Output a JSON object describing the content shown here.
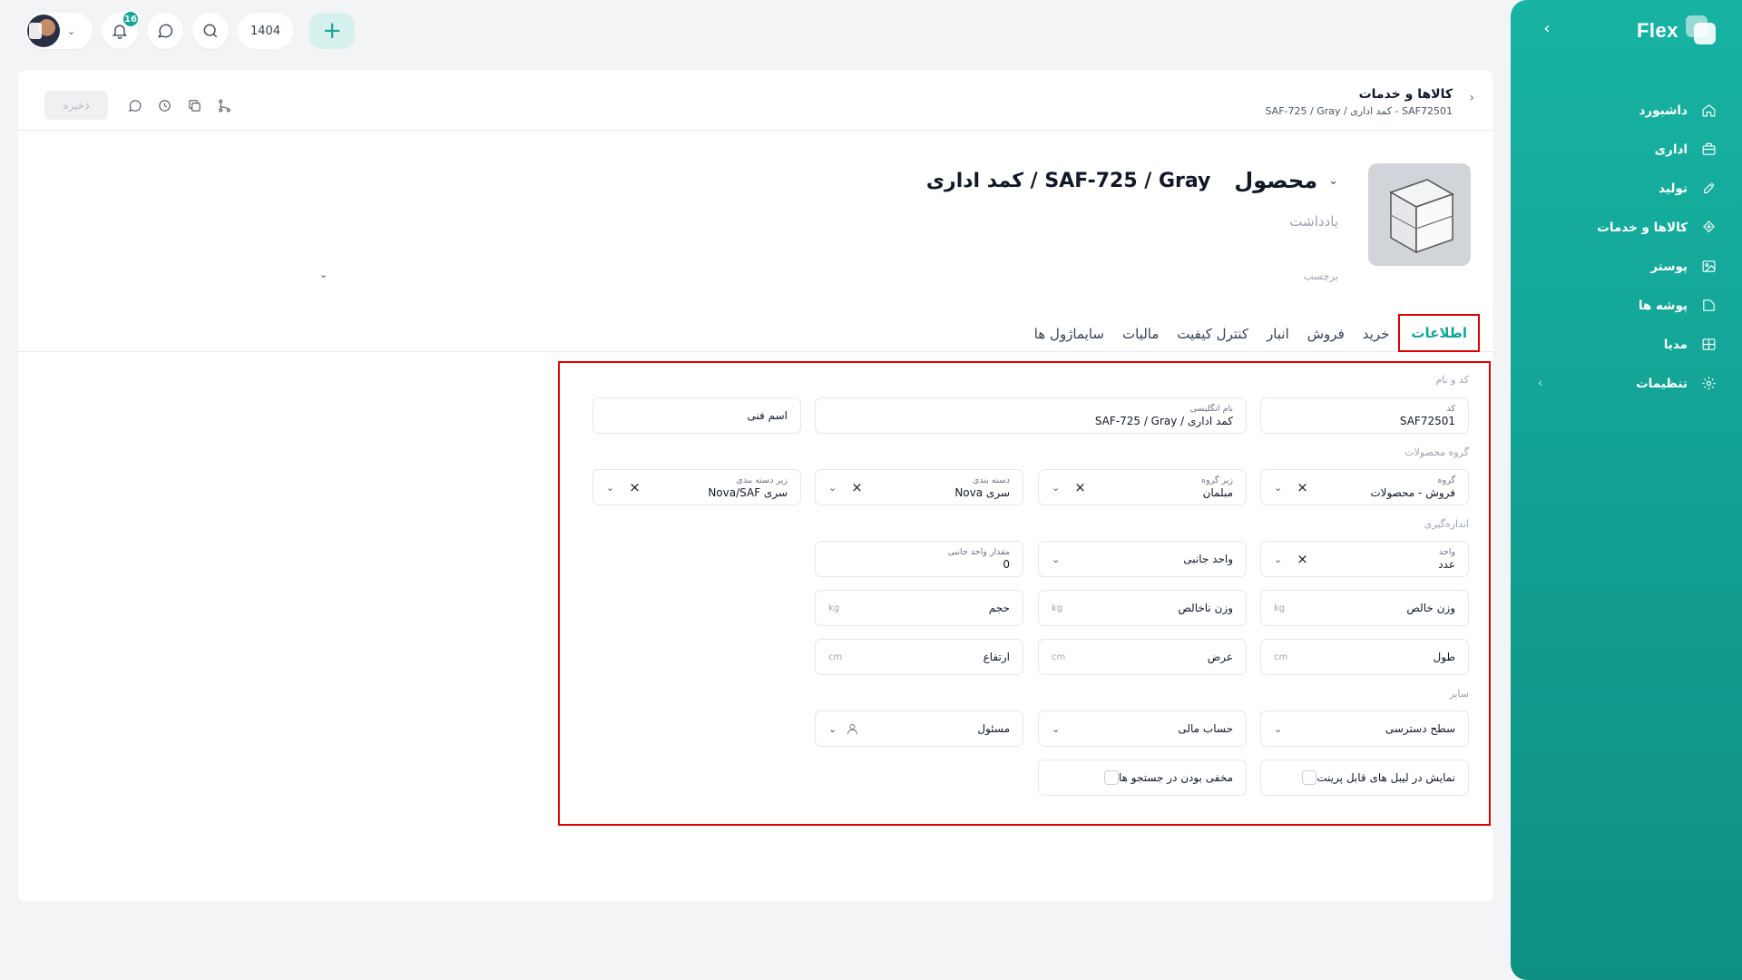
{
  "brand": {
    "name": "Flex"
  },
  "sidebar": {
    "items": [
      {
        "label": "داشبورد",
        "icon": "home-icon"
      },
      {
        "label": "اداری",
        "icon": "briefcase-icon"
      },
      {
        "label": "تولید",
        "icon": "tool-icon"
      },
      {
        "label": "کالاها و خدمات",
        "icon": "box-icon"
      },
      {
        "label": "پوستر",
        "icon": "image-icon"
      },
      {
        "label": "پوشه ها",
        "icon": "folder-icon"
      },
      {
        "label": "مدیا",
        "icon": "media-icon"
      },
      {
        "label": "تنظیمات",
        "icon": "gear-icon"
      }
    ]
  },
  "topbar": {
    "notification_count": "16",
    "year": "1404",
    "add_label": "+"
  },
  "header": {
    "save_label": "ذخیره",
    "breadcrumb_title": "کالاها و خدمات",
    "breadcrumb_sub": "SAF72501 - کمد اداری / SAF-725 / Gray"
  },
  "product": {
    "type": "محصول",
    "title": "کمد اداری / SAF-725 / Gray",
    "note_placeholder": "یادداشت",
    "tag_placeholder": "برچسب"
  },
  "tabs": [
    "اطلاعات",
    "خرید",
    "فروش",
    "انبار",
    "کنترل کیفیت",
    "مالیات",
    "سایماژول ها"
  ],
  "form": {
    "sections": {
      "code_name": "کد و نام",
      "group": "گروه محصولات",
      "measure": "اندازه‌گیری",
      "other": "سایر"
    },
    "code": {
      "caption": "کد",
      "value": "SAF72501"
    },
    "english_name": {
      "caption": "نام انگلیسی",
      "value": "کمد اداری / SAF-725 / Gray"
    },
    "technical_name": {
      "placeholder": "اسم فنی"
    },
    "group": {
      "caption": "گروه",
      "value": "فروش - محصولات"
    },
    "subgroup": {
      "caption": "زیر گروه",
      "value": "مبلمان"
    },
    "category": {
      "caption": "دسته بندی",
      "value": "سری Nova"
    },
    "subcategory": {
      "caption": "زیر دسته بندی",
      "value": "سری Nova/SAF"
    },
    "unit": {
      "caption": "واحد",
      "value": "عدد"
    },
    "side_unit": {
      "placeholder": "واحد جانبی"
    },
    "side_unit_amount": {
      "caption": "مقدار واحد جانبی",
      "value": "0"
    },
    "net_weight": {
      "placeholder": "وزن خالص",
      "unit": "kg"
    },
    "gross_weight": {
      "placeholder": "وزن ناخالص",
      "unit": "kg"
    },
    "volume": {
      "placeholder": "حجم",
      "unit": "kg"
    },
    "length": {
      "placeholder": "طول",
      "unit": "cm"
    },
    "width": {
      "placeholder": "عرض",
      "unit": "cm"
    },
    "height": {
      "placeholder": "ارتفاع",
      "unit": "cm"
    },
    "access_level": {
      "placeholder": "سطح دسترسی"
    },
    "financial_account": {
      "placeholder": "حساب مالی"
    },
    "responsible": {
      "placeholder": "مسئول"
    },
    "print_label": {
      "label": "نمایش در لیبل های قابل پرینت"
    },
    "hide_search": {
      "label": "مخفی بودن در جستجو ها"
    }
  }
}
